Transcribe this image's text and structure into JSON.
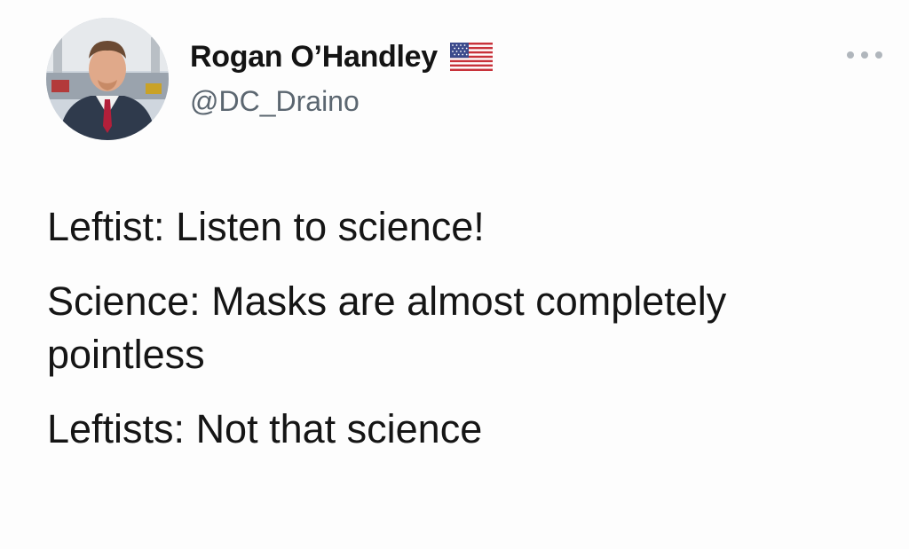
{
  "tweet": {
    "author": {
      "display_name": "Rogan O’Handley",
      "handle": "@DC_Draino",
      "flag_icon": "us-flag-icon",
      "avatar_icon": "profile-photo"
    },
    "more_icon": "more-options-icon",
    "paragraphs": [
      "Leftist: Listen to science!",
      "Science: Masks are almost completely pointless",
      "Leftists: Not that science"
    ]
  },
  "colors": {
    "background": "#fdfdfd",
    "text": "#151515",
    "handle": "#5b6670",
    "more_icon": "#b0b6bc"
  }
}
